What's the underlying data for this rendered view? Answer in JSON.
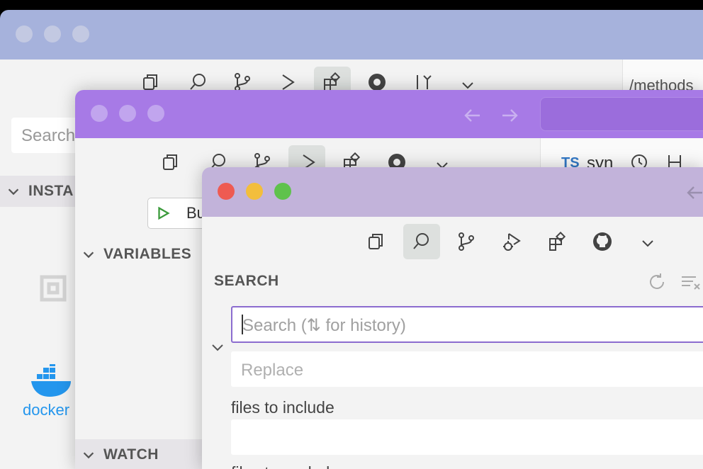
{
  "colors": {
    "win1_title": "#a6b2dc",
    "win2_title": "#a77ae6",
    "win3_title": "#c2b3da",
    "body": "#f3f3f3",
    "red": "#ee5b52",
    "yellow": "#f3be3c",
    "green": "#5fc24c",
    "focus_border": "#8b6ccf"
  },
  "window1": {
    "search_placeholder": "Search",
    "section_installed": "INSTA",
    "breadcrumb": "/methods",
    "docker_label": "docker"
  },
  "window2": {
    "run_button_label": "Bu",
    "section_variables": "VARIABLES",
    "section_watch": "WATCH",
    "tab_lang": "TS",
    "tab_name": "syn"
  },
  "window3": {
    "panel_title": "SEARCH",
    "search_placeholder": "Search (⇅ for history)",
    "replace_placeholder": "Replace",
    "files_include_label": "files to include",
    "files_exclude_label": "files to exclude"
  }
}
